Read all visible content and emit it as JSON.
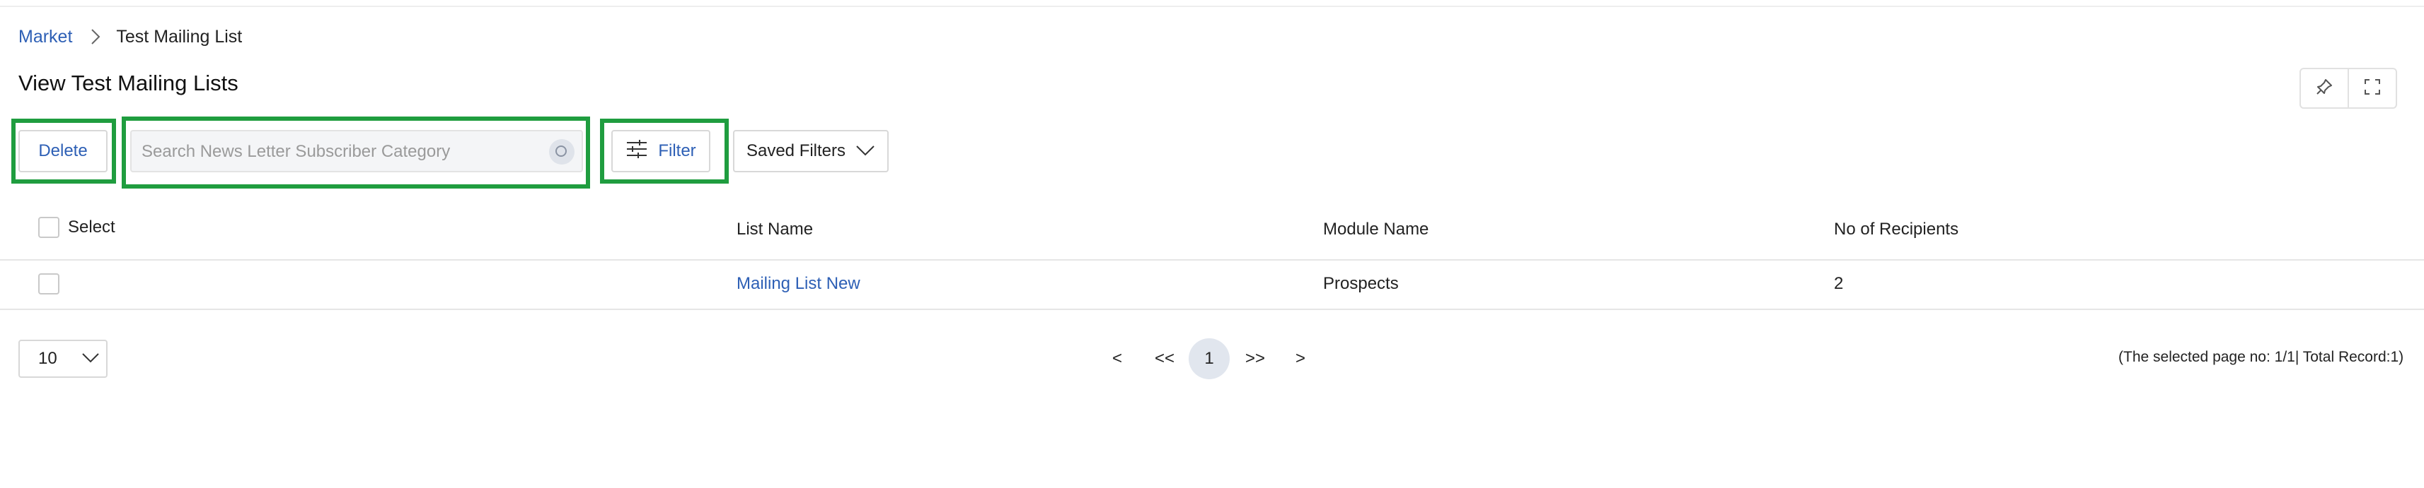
{
  "breadcrumb": {
    "root": "Market",
    "current": "Test Mailing List"
  },
  "page": {
    "title": "View Test Mailing Lists"
  },
  "toolbar": {
    "delete_label": "Delete",
    "search_placeholder": "Search News Letter Subscriber Category",
    "filter_label": "Filter",
    "saved_filters_label": "Saved Filters"
  },
  "table": {
    "columns": [
      "Select",
      "List Name",
      "Module Name",
      "No of Recipients"
    ],
    "rows": [
      {
        "list_name": "Mailing List New",
        "module_name": "Prospects",
        "recipients": "2"
      }
    ]
  },
  "pagination": {
    "page_size": "10",
    "prev": "<",
    "first": "<<",
    "current": "1",
    "last": ">>",
    "next": ">",
    "summary": "(The selected page no: 1/1| Total Record:1)"
  },
  "colors": {
    "accent": "#2d5fb5",
    "highlight": "#1f9d3f"
  },
  "icons": [
    "chevron-right-icon",
    "pin-icon",
    "expand-icon",
    "search-icon",
    "sliders-icon",
    "chevron-down-icon"
  ]
}
